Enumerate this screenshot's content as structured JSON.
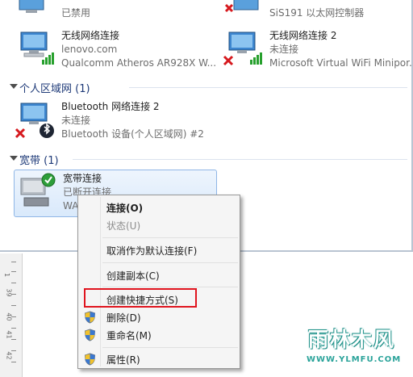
{
  "colors": {
    "group_header": "#1e3a78",
    "selection_fill": "#d9e9fb",
    "selection_border": "#8fb6e6",
    "highlight_box": "#e0141e",
    "watermark": "#2aa39a"
  },
  "top_row": {
    "left": {
      "status": "已禁用",
      "icon": "network-adapter-icon"
    },
    "right": {
      "adapter": "SiS191 以太网控制器",
      "icon": "network-adapter-disconnected-icon"
    }
  },
  "wireless": [
    {
      "name": "无线网络连接",
      "network": "lenovo.com",
      "adapter": "Qualcomm Atheros AR928X W...",
      "icon": "wireless-adapter-icon"
    },
    {
      "name": "无线网络连接 2",
      "network": "未连接",
      "adapter": "Microsoft Virtual WiFi Minipor...",
      "icon": "wireless-adapter-disconnected-icon"
    }
  ],
  "groups": {
    "pan": "个人区域网 (1)",
    "broadband": "宽带 (1)"
  },
  "bluetooth": {
    "name": "Bluetooth 网络连接 2",
    "status": "未连接",
    "device": "Bluetooth 设备(个人区域网) #2",
    "icon": "bluetooth-adapter-icon"
  },
  "broadband_item": {
    "name": "宽带连接",
    "status": "已断开连接",
    "device": "WA",
    "icon": "broadband-connection-icon"
  },
  "context_menu": {
    "items": [
      {
        "label": "连接(O)",
        "bold": true,
        "disabled": false,
        "shield": false
      },
      {
        "label": "状态(U)",
        "bold": false,
        "disabled": true,
        "shield": false
      },
      {
        "label": "取消作为默认连接(F)",
        "bold": false,
        "disabled": false,
        "shield": false
      },
      {
        "label": "创建副本(C)",
        "bold": false,
        "disabled": false,
        "shield": false
      },
      {
        "label": "创建快捷方式(S)",
        "bold": false,
        "disabled": false,
        "shield": false
      },
      {
        "label": "删除(D)",
        "bold": false,
        "disabled": false,
        "shield": true
      },
      {
        "label": "重命名(M)",
        "bold": false,
        "disabled": false,
        "shield": true
      },
      {
        "label": "属性(R)",
        "bold": false,
        "disabled": false,
        "shield": true
      }
    ]
  },
  "ruler": {
    "labels": [
      "1",
      "39",
      "40",
      "41",
      "42"
    ]
  },
  "watermark": {
    "title": "雨林木风",
    "url": "WWW.YLMFU.COM"
  }
}
